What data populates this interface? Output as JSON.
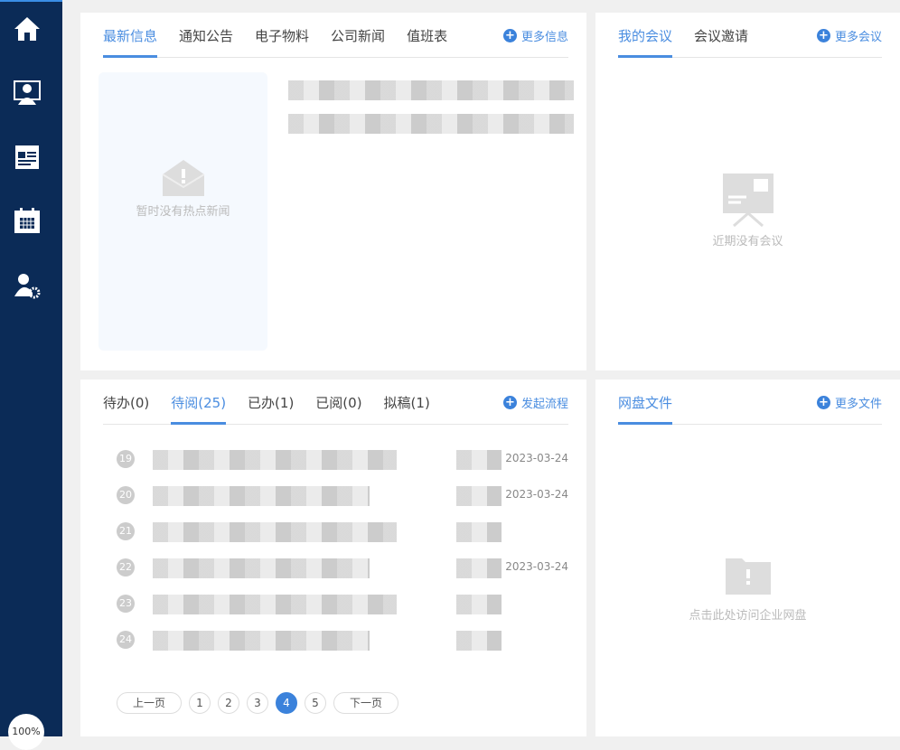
{
  "sidebar": {
    "items": [
      {
        "icon": "home-icon"
      },
      {
        "icon": "meeting-user-icon"
      },
      {
        "icon": "news-icon"
      },
      {
        "icon": "calendar-icon"
      },
      {
        "icon": "user-settings-icon"
      }
    ],
    "zoom": "100%"
  },
  "news": {
    "tabs": [
      "最新信息",
      "通知公告",
      "电子物料",
      "公司新闻",
      "值班表"
    ],
    "more": "更多信息",
    "empty": "暂时没有热点新闻"
  },
  "meeting": {
    "tabs": [
      "我的会议",
      "会议邀请"
    ],
    "more": "更多会议",
    "empty": "近期没有会议"
  },
  "flow": {
    "tabs": [
      "待办(0)",
      "待阅(25)",
      "已办(1)",
      "已阅(0)",
      "拟稿(1)"
    ],
    "more": "发起流程",
    "rows": [
      {
        "num": "19",
        "date": "2023-03-24"
      },
      {
        "num": "20",
        "date": "2023-03-24"
      },
      {
        "num": "21",
        "date": ""
      },
      {
        "num": "22",
        "date": "2023-03-24"
      },
      {
        "num": "23",
        "date": ""
      },
      {
        "num": "24",
        "date": ""
      }
    ],
    "pager": {
      "prev": "上一页",
      "pages": [
        "1",
        "2",
        "3",
        "4",
        "5"
      ],
      "current": "4",
      "next": "下一页"
    }
  },
  "disk": {
    "tabs": [
      "网盘文件"
    ],
    "more": "更多文件",
    "empty": "点击此处访问企业网盘"
  },
  "colors": {
    "accent": "#4a8de0",
    "sidebar": "#0b2b57"
  }
}
